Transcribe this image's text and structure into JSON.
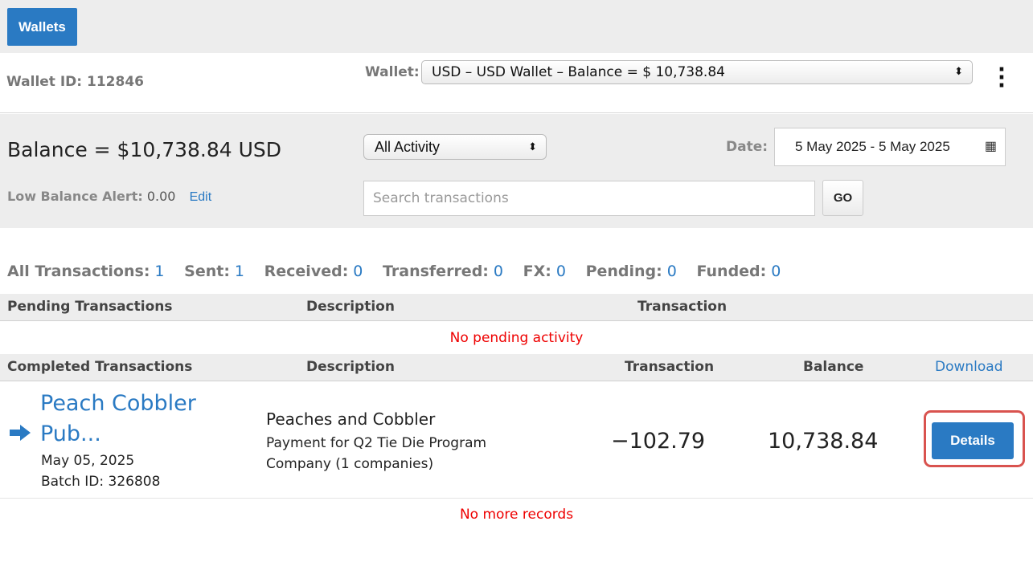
{
  "topbar": {
    "wallets_label": "Wallets"
  },
  "wallet": {
    "id_text": "Wallet ID: 112846",
    "select_label": "Wallet:",
    "selected": "USD – USD Wallet – Balance = $ 10,738.84"
  },
  "summary": {
    "balance": "Balance = $10,738.84 USD",
    "activity_selected": "All Activity",
    "date_label": "Date:",
    "date_range": "5 May 2025 - 5 May 2025",
    "low_alert_label": "Low Balance Alert:",
    "low_alert_value": "0.00",
    "edit_label": "Edit",
    "search_placeholder": "Search transactions",
    "go_label": "GO"
  },
  "counts": [
    {
      "label": "All Transactions:",
      "value": "1"
    },
    {
      "label": "Sent:",
      "value": "1"
    },
    {
      "label": "Received:",
      "value": "0"
    },
    {
      "label": "Transferred:",
      "value": "0"
    },
    {
      "label": "FX:",
      "value": "0"
    },
    {
      "label": "Pending:",
      "value": "0"
    },
    {
      "label": "Funded:",
      "value": "0"
    }
  ],
  "pending": {
    "headers": [
      "Pending Transactions",
      "Description",
      "Transaction"
    ],
    "empty_msg": "No pending activity"
  },
  "completed": {
    "headers": [
      "Completed Transactions",
      "Description",
      "Transaction",
      "Balance"
    ],
    "download_label": "Download",
    "rows": [
      {
        "payee_line1": "Peach Cobbler",
        "payee_line2": "Pub...",
        "date": "May 05, 2025",
        "batch": "Batch ID: 326808",
        "desc_title": "Peaches and Cobbler",
        "desc_line1": "Payment for Q2 Tie Die Program",
        "desc_line2": "Company (1 companies)",
        "amount": "−102.79",
        "balance": "10,738.84",
        "details_label": "Details"
      }
    ],
    "end_msg": "No more records"
  },
  "colors": {
    "accent": "#2a7ac3",
    "panel": "#ededed",
    "alert": "#e00000",
    "highlight": "#d9534f"
  },
  "icons": {
    "row_icon": "arrow-right-icon",
    "date_icon": "calendar-icon",
    "menu_icon": "kebab-menu-icon"
  }
}
